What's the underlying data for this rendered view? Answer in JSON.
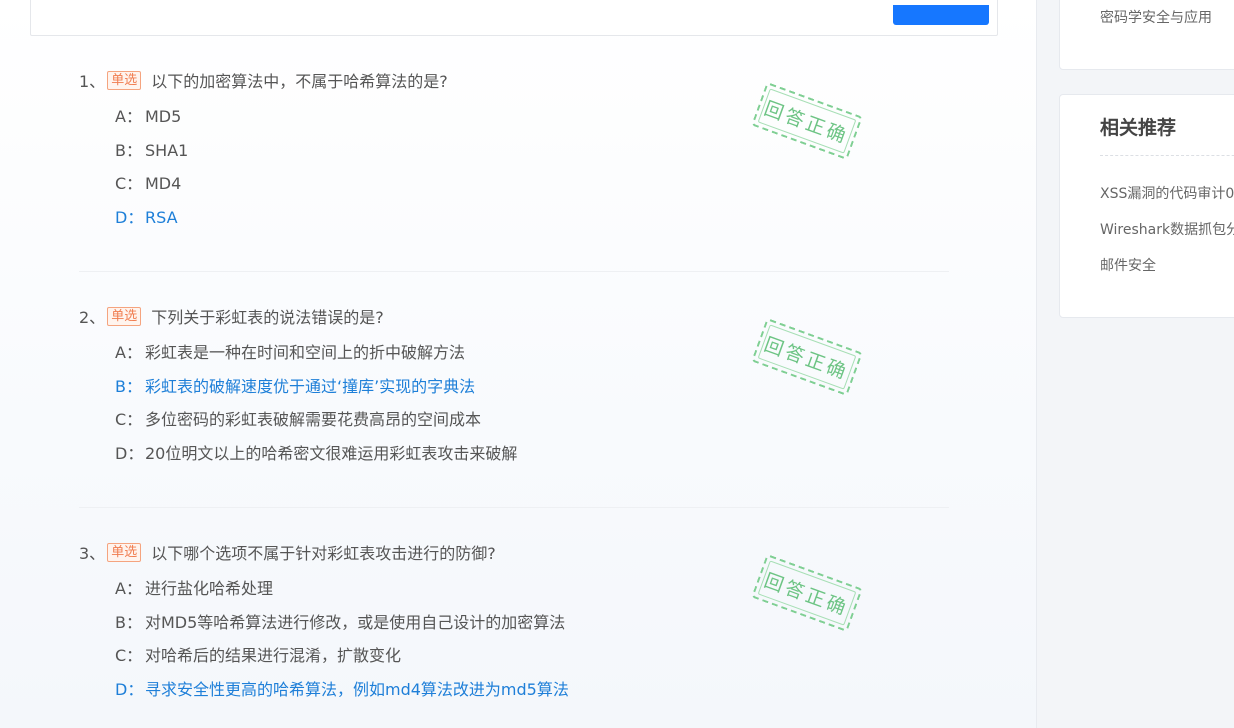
{
  "sidebar": {
    "top_link": "密码学安全与应用",
    "recommend_title": "相关推荐",
    "recommend_items": [
      "XSS漏洞的代码审计0",
      "Wireshark数据抓包分",
      "邮件安全"
    ]
  },
  "stamp_text": "回答正确",
  "questions": [
    {
      "number": "1、",
      "type": "单选",
      "text": "以下的加密算法中，不属于哈希算法的是?",
      "options": [
        {
          "letter": "A：",
          "text": "MD5"
        },
        {
          "letter": "B：",
          "text": "SHA1"
        },
        {
          "letter": "C：",
          "text": "MD4"
        },
        {
          "letter": "D：",
          "text": "RSA"
        }
      ],
      "correct": "D"
    },
    {
      "number": "2、",
      "type": "单选",
      "text": "下列关于彩虹表的说法错误的是?",
      "options": [
        {
          "letter": "A：",
          "text": "彩虹表是一种在时间和空间上的折中破解方法"
        },
        {
          "letter": "B：",
          "text": "彩虹表的破解速度优于通过‘撞库’实现的字典法"
        },
        {
          "letter": "C：",
          "text": "多位密码的彩虹表破解需要花费高昂的空间成本"
        },
        {
          "letter": "D：",
          "text": "20位明文以上的哈希密文很难运用彩虹表攻击来破解"
        }
      ],
      "correct": "B"
    },
    {
      "number": "3、",
      "type": "单选",
      "text": "以下哪个选项不属于针对彩虹表攻击进行的防御?",
      "options": [
        {
          "letter": "A：",
          "text": "进行盐化哈希处理"
        },
        {
          "letter": "B：",
          "text": "对MD5等哈希算法进行修改，或是使用自己设计的加密算法"
        },
        {
          "letter": "C：",
          "text": "对哈希后的结果进行混淆，扩散变化"
        },
        {
          "letter": "D：",
          "text": "寻求安全性更高的哈希算法，例如md4算法改进为md5算法"
        }
      ],
      "correct": "D"
    }
  ]
}
